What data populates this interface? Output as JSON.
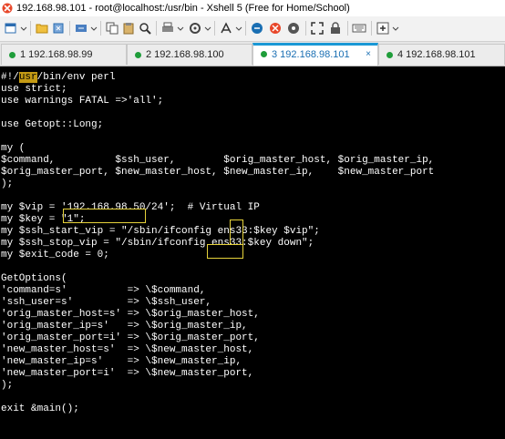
{
  "window": {
    "title": "192.168.98.101 - root@localhost:/usr/bin - Xshell 5 (Free for Home/School)"
  },
  "toolbar": {
    "icons": [
      "new-session-icon",
      "open-icon",
      "reconnect-icon",
      "disconnect-icon",
      "copy-icon",
      "paste-icon",
      "find-icon",
      "print-icon",
      "options-icon",
      "font-icon",
      "xftp-icon",
      "xagent-icon",
      "fullscreen-icon",
      "lock-icon",
      "keyboard-icon",
      "add-icon"
    ]
  },
  "tabs": [
    {
      "label": "1 192.168.98.99",
      "color": "#1f9d3a",
      "active": false
    },
    {
      "label": "2 192.168.98.100",
      "color": "#1f9d3a",
      "active": false
    },
    {
      "label": "3 192.168.98.101",
      "color": "#1f9d3a",
      "active": true,
      "close": "×"
    },
    {
      "label": "4 192.168.98.101",
      "color": "#1f9d3a",
      "active": false
    }
  ],
  "terminal": {
    "shebang_prefix": "#!/",
    "shebang_hl": "usr",
    "shebang_rest": "/bin/env perl",
    "lines_a": [
      "use strict;",
      "use warnings FATAL =>'all';",
      "",
      "use Getopt::Long;",
      "",
      "my (",
      "$command,          $ssh_user,        $orig_master_host, $orig_master_ip,",
      "$orig_master_port, $new_master_host, $new_master_ip,    $new_master_port",
      ");",
      ""
    ],
    "vip_line": "my $vip = '192.168.98.50/24';  # Virtual IP",
    "lines_b": [
      "my $key = \"1\";",
      "my $ssh_start_vip = \"/sbin/ifconfig ens33:$key $vip\";",
      "my $ssh_stop_vip = \"/sbin/ifconfig ens33:$key down\";",
      "my $exit_code = 0;",
      "",
      "GetOptions(",
      "'command=s'          => \\$command,",
      "'ssh_user=s'         => \\$ssh_user,",
      "'orig_master_host=s' => \\$orig_master_host,",
      "'orig_master_ip=s'   => \\$orig_master_ip,",
      "'orig_master_port=i' => \\$orig_master_port,",
      "'new_master_host=s'  => \\$new_master_host,",
      "'new_master_ip=s'    => \\$new_master_ip,",
      "'new_master_port=i'  => \\$new_master_port,",
      ");",
      "",
      "exit &main();"
    ]
  }
}
